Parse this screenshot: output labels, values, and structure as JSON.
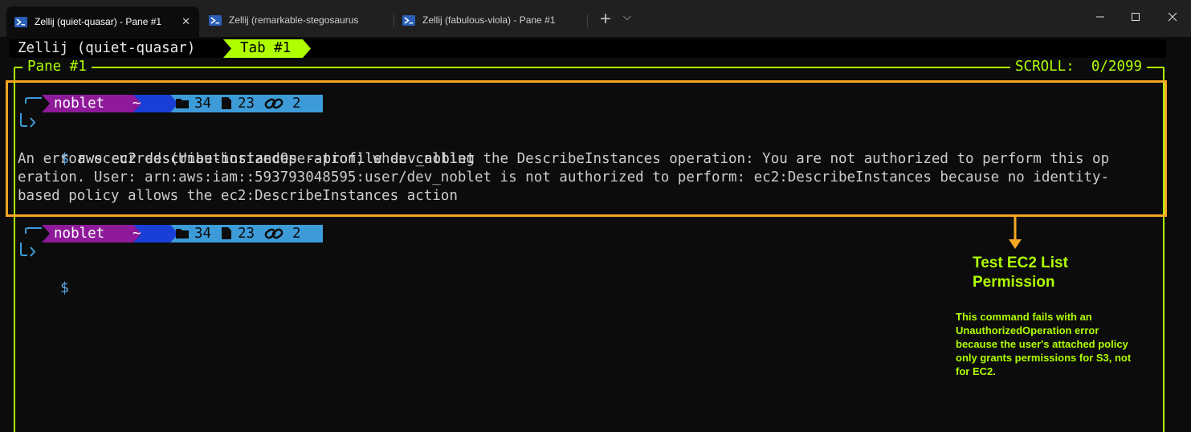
{
  "window": {
    "tabs": [
      {
        "label": "Zellij (quiet-quasar) - Pane #1",
        "active": true
      },
      {
        "label": "Zellij (remarkable-stegosaurus",
        "active": false
      },
      {
        "label": "Zellij (fabulous-viola) - Pane #1",
        "active": false
      }
    ],
    "new_tab_glyph": "+",
    "dropdown_glyph": "⌵"
  },
  "zellij": {
    "session_name": "Zellij (quiet-quasar)",
    "tab_label": "Tab #1",
    "pane_title": "Pane #1",
    "scroll_label": "SCROLL:",
    "scroll_value": "0/2099"
  },
  "prompt": {
    "user": "noblet",
    "path": "~",
    "folders": "34",
    "files": "23",
    "links": "2",
    "symbol": "$"
  },
  "terminal": {
    "command": "aws ec2 describe-instances --profile dev_noblet",
    "error_lines": [
      "An error occurred (UnauthorizedOperation) when calling the DescribeInstances operation: You are not authorized to perform this op",
      "eration. User: arn:aws:iam::593793048595:user/dev_noblet is not authorized to perform: ec2:DescribeInstances because no identity-",
      "based policy allows the ec2:DescribeInstances action"
    ]
  },
  "annotation": {
    "title": "Test EC2 List Permission",
    "body": "This command fails with an UnauthorizedOperation error because the user's attached policy only grants permissions for S3, not for EC2."
  },
  "colors": {
    "accent_green": "#afff00",
    "highlight_orange": "#f5a623",
    "prompt_purple": "#8e1a9a",
    "prompt_blue": "#1a3fd6",
    "prompt_cyan": "#3d9bd8"
  }
}
